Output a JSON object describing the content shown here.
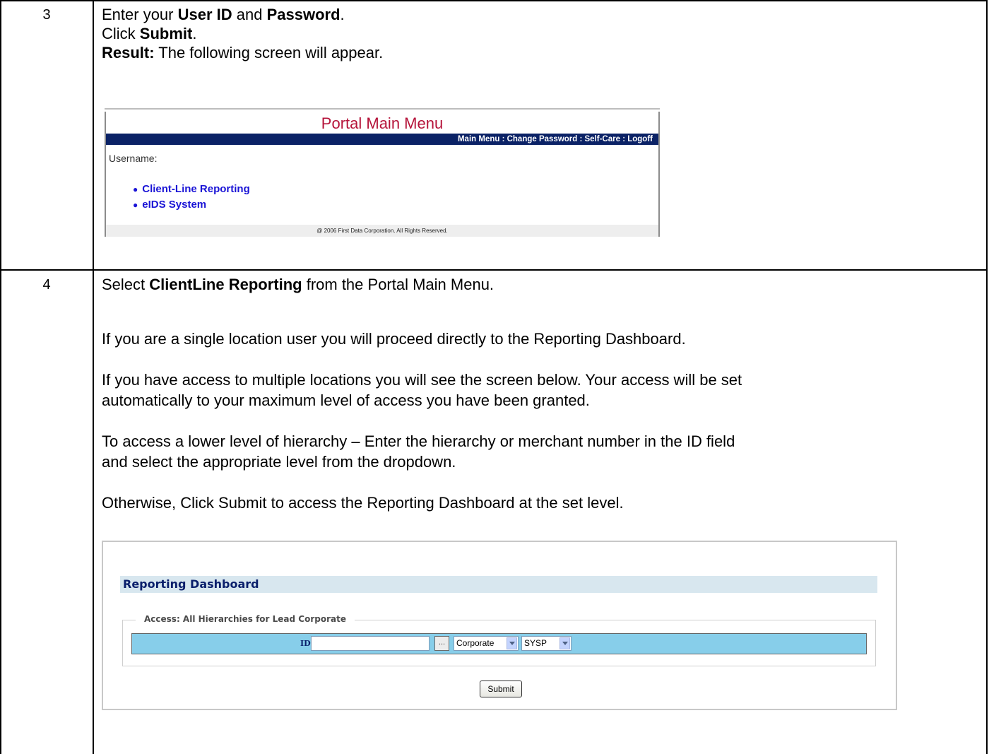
{
  "steps": [
    {
      "number": "3",
      "lines": {
        "l1_pre": "Enter your ",
        "l1_b1": "User ID",
        "l1_mid": " and ",
        "l1_b2": "Password",
        "l1_end": ".",
        "l2_pre": "Click ",
        "l2_b": "Submit",
        "l2_end": ".",
        "l3_b": "Result:",
        "l3_rest": " The following screen will appear."
      },
      "portal": {
        "title": "Portal Main Menu",
        "nav": "Main Menu   : Change Password   : Self-Care   : Logoff",
        "username_label": "Username:",
        "links": [
          "Client-Line Reporting",
          "eIDS System"
        ],
        "footer": "@ 2006 First Data Corporation. All Rights Reserved."
      }
    },
    {
      "number": "4",
      "p1_pre": "Select ",
      "p1_b": "ClientLine Reporting",
      "p1_rest": " from the Portal Main Menu.",
      "p2": "If you are a single location user you will proceed directly to the Reporting Dashboard.",
      "p3a": "If you have access to multiple locations you will see the screen below. Your access will be set",
      "p3b": "automatically to your maximum level of access you have been granted.",
      "p4a": "To access a lower level of hierarchy – Enter the hierarchy or merchant number in the ID field",
      "p4b": "and select the appropriate level from the dropdown.",
      "p5": "Otherwise, Click Submit to access the Reporting Dashboard at the set level.",
      "dashboard": {
        "title": "Reporting Dashboard",
        "access_legend": "Access: All Hierarchies for Lead Corporate",
        "id_label": "ID",
        "id_value": "",
        "lookup_label": "...",
        "level_select": "Corporate",
        "system_select": "SYSP",
        "submit_label": "Submit"
      }
    }
  ]
}
